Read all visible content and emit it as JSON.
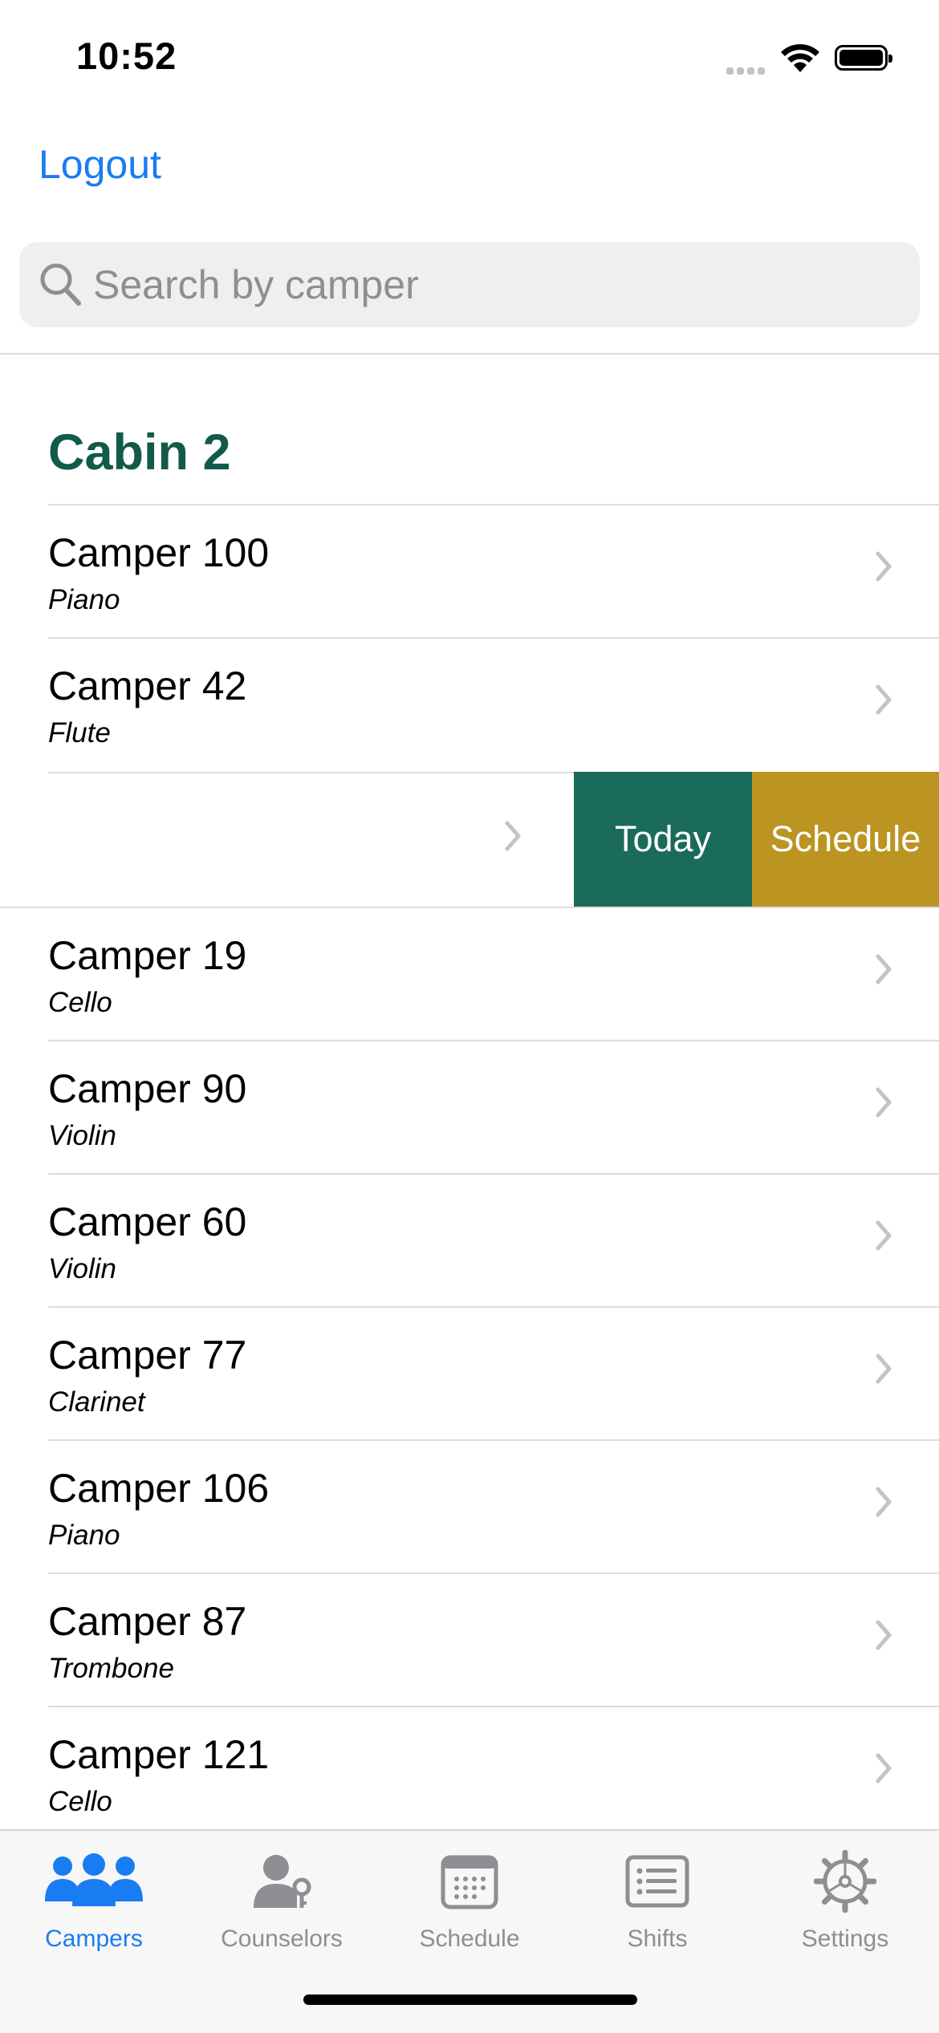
{
  "status_bar": {
    "time": "10:52"
  },
  "nav": {
    "logout_label": "Logout"
  },
  "search": {
    "placeholder": "Search by camper"
  },
  "section": {
    "title": "Cabin 2"
  },
  "campers_top": [
    {
      "name": "Camper 100",
      "instrument": "Piano"
    },
    {
      "name": "Camper 42",
      "instrument": "Flute"
    }
  ],
  "swipe_actions": {
    "today": "Today",
    "schedule": "Schedule"
  },
  "campers_bottom": [
    {
      "name": "Camper 19",
      "instrument": "Cello"
    },
    {
      "name": "Camper 90",
      "instrument": "Violin"
    },
    {
      "name": "Camper 60",
      "instrument": "Violin"
    },
    {
      "name": "Camper 77",
      "instrument": "Clarinet"
    },
    {
      "name": "Camper 106",
      "instrument": "Piano"
    },
    {
      "name": "Camper 87",
      "instrument": "Trombone"
    },
    {
      "name": "Camper 121",
      "instrument": "Cello"
    }
  ],
  "tabs": [
    {
      "label": "Campers",
      "icon": "people-icon",
      "active": true
    },
    {
      "label": "Counselors",
      "icon": "person-key-icon",
      "active": false
    },
    {
      "label": "Schedule",
      "icon": "calendar-icon",
      "active": false
    },
    {
      "label": "Shifts",
      "icon": "list-icon",
      "active": false
    },
    {
      "label": "Settings",
      "icon": "gear-icon",
      "active": false
    }
  ],
  "colors": {
    "accent": "#1a7cf2",
    "section_header": "#125a4a",
    "today_action": "#1b6b5b",
    "schedule_action": "#bb9421",
    "inactive_tab": "#8e8e93"
  }
}
